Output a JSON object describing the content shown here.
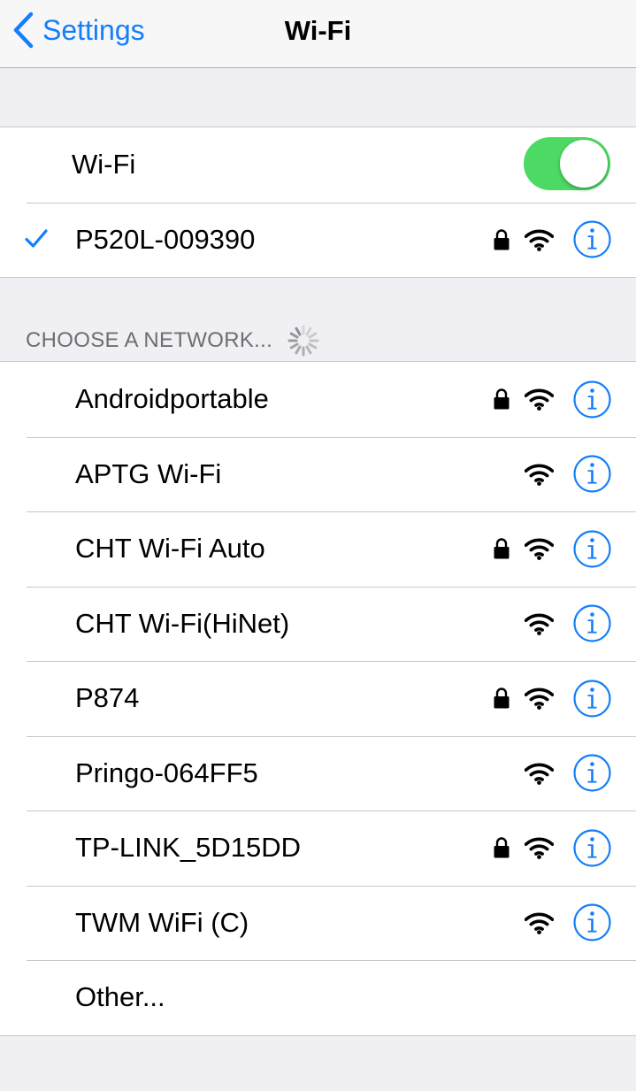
{
  "navbar": {
    "back_label": "Settings",
    "title": "Wi-Fi"
  },
  "wifi_toggle": {
    "label": "Wi-Fi",
    "on": true,
    "on_color": "#4cd964"
  },
  "connected": {
    "name": "P520L-009390",
    "secured": true,
    "checkmark_color": "#147efb"
  },
  "networks_section": {
    "header": "CHOOSE A NETWORK...",
    "loading": true
  },
  "networks": [
    {
      "name": "Androidportable",
      "secured": true
    },
    {
      "name": "APTG Wi-Fi",
      "secured": false
    },
    {
      "name": "CHT Wi-Fi Auto",
      "secured": true
    },
    {
      "name": "CHT Wi-Fi(HiNet)",
      "secured": false
    },
    {
      "name": "P874",
      "secured": true
    },
    {
      "name": "Pringo-064FF5",
      "secured": false
    },
    {
      "name": "TP-LINK_5D15DD",
      "secured": true
    },
    {
      "name": "TWM WiFi (C)",
      "secured": false
    }
  ],
  "other": {
    "label": "Other..."
  },
  "icons": {
    "back": "chevron-left-icon",
    "check": "checkmark-icon",
    "lock": "lock-icon",
    "wifi": "wifi-signal-icon",
    "info": "info-icon",
    "spinner": "loading-spinner-icon"
  },
  "colors": {
    "accent": "#147efb",
    "background": "#efeff4",
    "separator": "#c8c7cc"
  }
}
